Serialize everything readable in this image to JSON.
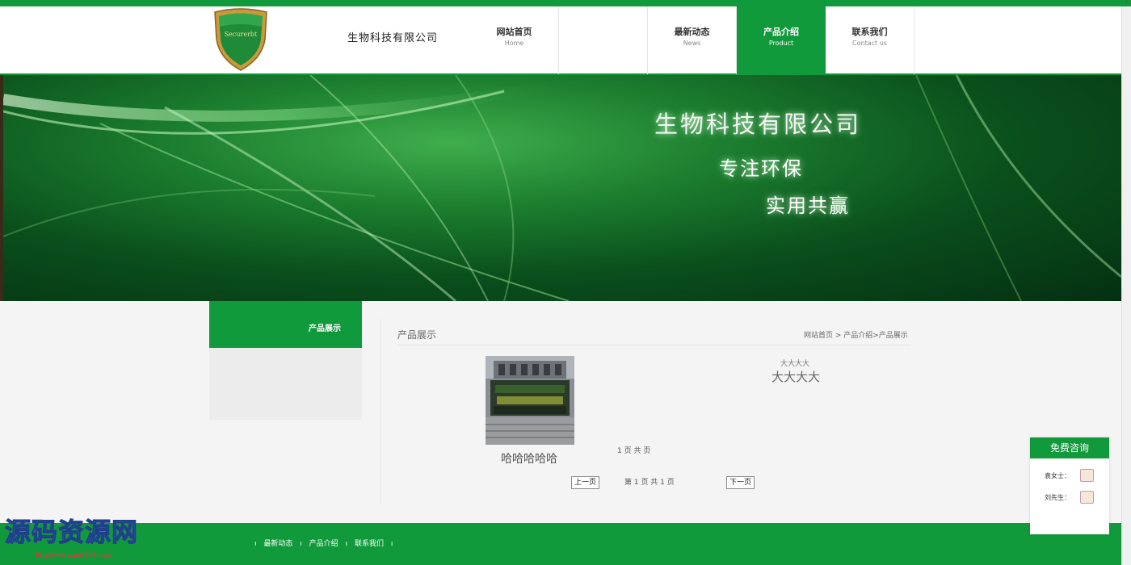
{
  "header": {
    "logo_text": "Securerbt",
    "company_name": "生物科技有限公司"
  },
  "nav": [
    {
      "zh": "网站首页",
      "en": "Home"
    },
    {
      "zh": "",
      "en": ""
    },
    {
      "zh": "最新动态",
      "en": "News"
    },
    {
      "zh": "产品介绍",
      "en": "Product"
    },
    {
      "zh": "联系我们",
      "en": "Contact us"
    }
  ],
  "banner": {
    "title": "生物科技有限公司",
    "sub1": "专注环保",
    "sub2": "实用共赢"
  },
  "sidebar": {
    "heading": "产品展示"
  },
  "main": {
    "section_title": "产品展示",
    "breadcrumb": "网站首页 > 产品介绍>产品展示",
    "product_name": "哈哈哈哈哈",
    "mid_pager": "1 页   共 页",
    "detail_small": "大大大大",
    "detail_big": "大大大大",
    "prev_label": "上一页",
    "next_label": "下一页",
    "pager_text": "第  1  页    共  1  页"
  },
  "footer": {
    "links": [
      "最新动态",
      "产品介绍",
      "联系我们"
    ]
  },
  "watermark": {
    "title": "源码资源网",
    "url": "http://www.net188.com"
  },
  "consult": {
    "title": "免费咨询",
    "contacts": [
      {
        "name": "袁女士："
      },
      {
        "name": "刘先生："
      }
    ]
  }
}
